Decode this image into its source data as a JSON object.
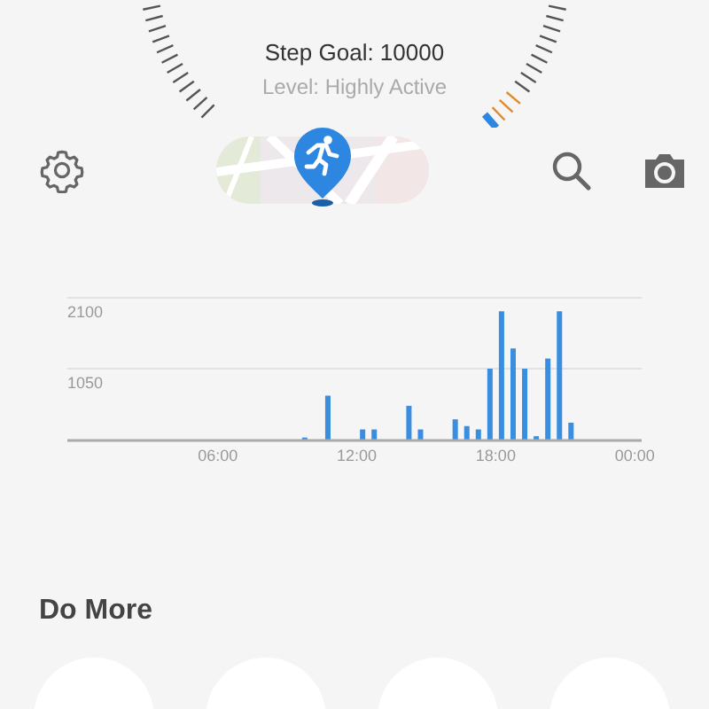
{
  "header": {
    "goal": "Step Goal: 10000",
    "level_text": "Level: Highly Active"
  },
  "activity_chart": {
    "chart_data": {
      "type": "bar",
      "x": [
        9.75,
        10.75,
        12.25,
        12.75,
        14.25,
        14.75,
        16.25,
        16.75,
        17.25,
        17.75,
        18.25,
        18.75,
        19.25,
        19.75,
        20.25,
        20.75,
        21.25
      ],
      "series": [
        {
          "color": "#3a8ee0",
          "values": [
            30,
            650,
            150,
            150,
            500,
            150,
            300,
            200,
            150,
            1050,
            1900,
            1350,
            1050,
            50,
            1200,
            1900,
            250
          ]
        }
      ],
      "xlim": [
        -0.5,
        24.3
      ],
      "ylim": [
        0,
        2100
      ],
      "xticks": [
        {
          "value": 6,
          "label": "06:00"
        },
        {
          "value": 12,
          "label": "12:00"
        },
        {
          "value": 18,
          "label": "18:00"
        },
        {
          "value": 24,
          "label": "00:00"
        }
      ],
      "yticks": [
        {
          "value": 1050,
          "label": "1050"
        },
        {
          "value": 2100,
          "label": "2100"
        }
      ]
    }
  },
  "do_more": {
    "title": "Do More"
  }
}
